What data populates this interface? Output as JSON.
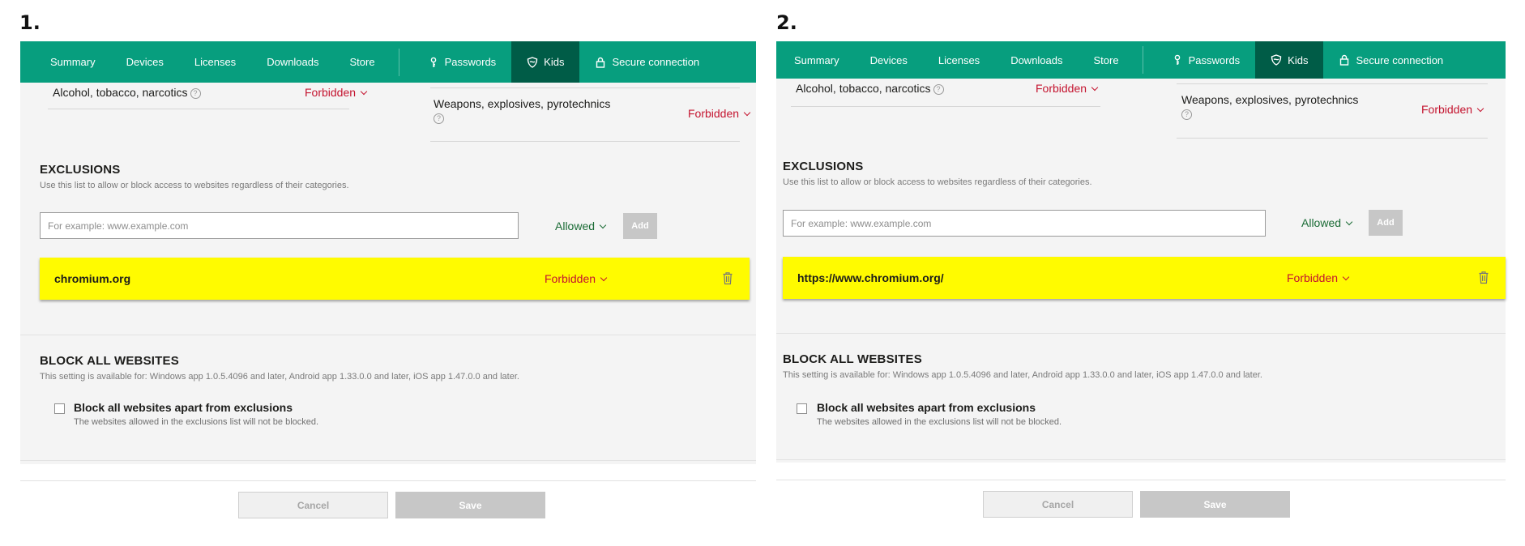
{
  "panels": [
    {
      "number": "1.",
      "nav": {
        "items": [
          "Summary",
          "Devices",
          "Licenses",
          "Downloads",
          "Store"
        ],
        "passwords": "Passwords",
        "kids": "Kids",
        "secure": "Secure connection"
      },
      "categories": {
        "left_label": "Alcohol, tobacco, narcotics",
        "left_value": "Forbidden",
        "right_label_line1": "Weapons, explosives, pyrotechnics",
        "right_value": "Forbidden"
      },
      "exclusions": {
        "title": "EXCLUSIONS",
        "description": "Use this list to allow or block access to websites regardless of their categories.",
        "input_placeholder": "For example: www.example.com",
        "mode_value": "Allowed",
        "add_label": "Add",
        "entry_site": "chromium.org",
        "entry_status": "Forbidden"
      },
      "block_all": {
        "title": "BLOCK ALL WEBSITES",
        "description": "This setting is available for: Windows app 1.0.5.4096 and later, Android app 1.33.0.0 and later, iOS app 1.47.0.0 and later.",
        "checkbox_label": "Block all websites apart from exclusions",
        "checkbox_sub": "The websites allowed in the exclusions list will not be blocked."
      },
      "footer": {
        "cancel": "Cancel",
        "save": "Save"
      }
    },
    {
      "number": "2.",
      "nav": {
        "items": [
          "Summary",
          "Devices",
          "Licenses",
          "Downloads",
          "Store"
        ],
        "passwords": "Passwords",
        "kids": "Kids",
        "secure": "Secure connection"
      },
      "categories": {
        "left_label": "Alcohol, tobacco, narcotics",
        "left_value": "Forbidden",
        "right_label_line1": "Weapons, explosives, pyrotechnics",
        "right_value": "Forbidden"
      },
      "exclusions": {
        "title": "EXCLUSIONS",
        "description": "Use this list to allow or block access to websites regardless of their categories.",
        "input_placeholder": "For example: www.example.com",
        "mode_value": "Allowed",
        "add_label": "Add",
        "entry_site": "https://www.chromium.org/",
        "entry_status": "Forbidden"
      },
      "block_all": {
        "title": "BLOCK ALL WEBSITES",
        "description": "This setting is available for: Windows app 1.0.5.4096 and later, Android app 1.33.0.0 and later, iOS app 1.47.0.0 and later.",
        "checkbox_label": "Block all websites apart from exclusions",
        "checkbox_sub": "The websites allowed in the exclusions list will not be blocked."
      },
      "footer": {
        "cancel": "Cancel",
        "save": "Save"
      }
    }
  ],
  "colors": {
    "nav_bg": "#079e7e",
    "nav_active": "#005c47",
    "forbidden": "#c4142f",
    "allowed": "#1a6b35",
    "highlight": "#fffb00"
  },
  "icons": [
    "key-icon",
    "shield-icon",
    "lock-icon",
    "help-icon",
    "chevron-down-icon",
    "trash-icon"
  ]
}
